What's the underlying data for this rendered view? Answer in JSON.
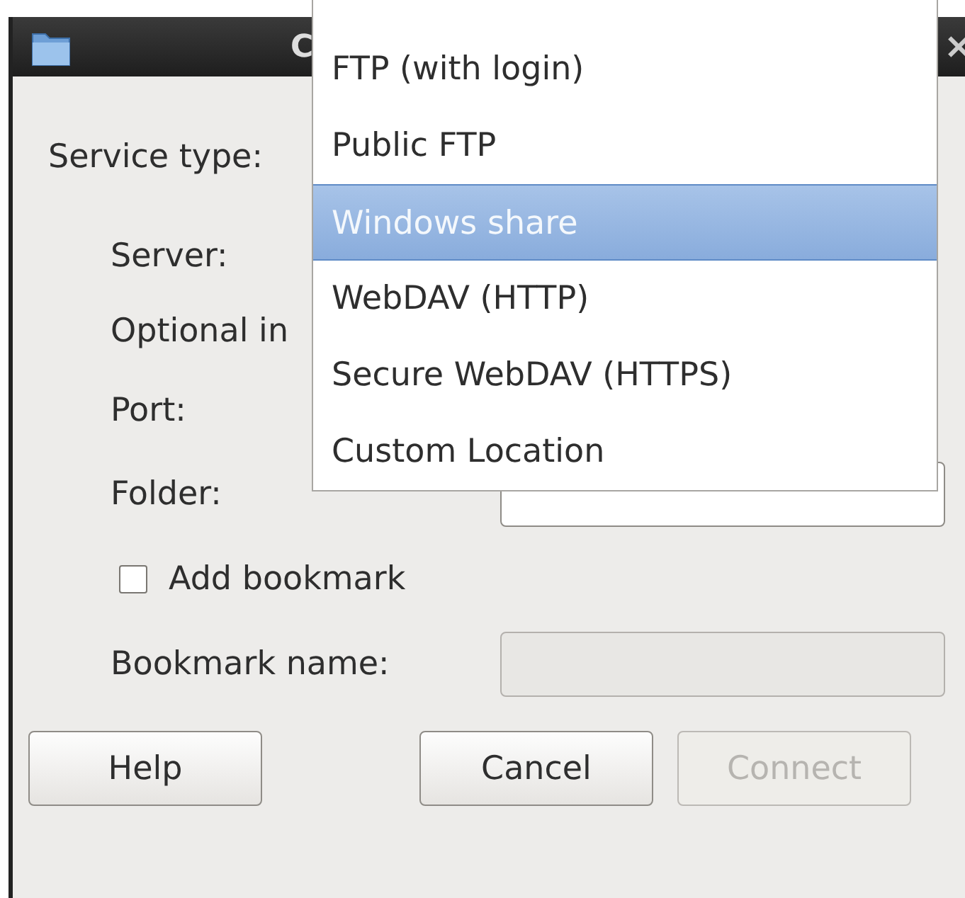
{
  "window": {
    "title": "C"
  },
  "service_type": {
    "label": "Service type:"
  },
  "fields": [
    {
      "kind": "label",
      "label": "Server:"
    },
    {
      "kind": "label",
      "label": "Optional in"
    },
    {
      "kind": "label",
      "label": "Port:"
    },
    {
      "kind": "input",
      "label": "Folder:",
      "disabled": false
    },
    {
      "kind": "checkbox",
      "label": "Add bookmark",
      "checked": false
    },
    {
      "kind": "input",
      "label": "Bookmark name:",
      "disabled": true
    }
  ],
  "buttons": [
    {
      "label": "Help",
      "disabled": false
    },
    {
      "label": "Cancel",
      "disabled": false
    },
    {
      "label": "Connect",
      "disabled": true
    }
  ],
  "dropdown_menu": {
    "items": [
      {
        "label": "FTP (with login)",
        "selected": false
      },
      {
        "label": "Public FTP",
        "selected": false
      },
      {
        "label": "Windows share",
        "selected": true
      },
      {
        "label": "WebDAV (HTTP)",
        "selected": false
      },
      {
        "label": "Secure WebDAV (HTTPS)",
        "selected": false
      },
      {
        "label": "Custom Location",
        "selected": false
      }
    ]
  }
}
